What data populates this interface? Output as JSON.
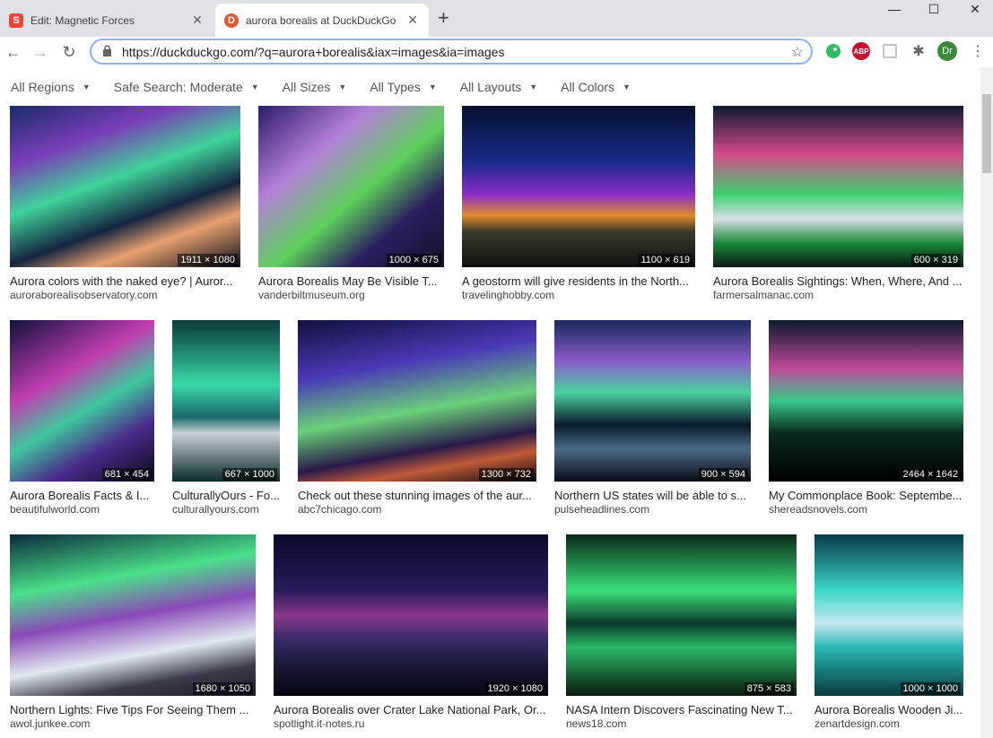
{
  "tabs": [
    {
      "title": "Edit: Magnetic Forces",
      "favicon": "S"
    },
    {
      "title": "aurora borealis at DuckDuckGo",
      "favicon": "D"
    }
  ],
  "address": {
    "url": "https://duckduckgo.com/?q=aurora+borealis&iax=images&ia=images"
  },
  "profile": {
    "initials": "Dr"
  },
  "extensions": {
    "abp": "ABP"
  },
  "filters": [
    "All Regions",
    "Safe Search: Moderate",
    "All Sizes",
    "All Types",
    "All Layouts",
    "All Colors"
  ],
  "results": [
    {
      "caption": "Aurora colors with the naked eye? | Auror...",
      "source": "auroraborealisobservatory.com",
      "dims": "1911 × 1080"
    },
    {
      "caption": "Aurora Borealis May Be Visible T...",
      "source": "vanderbiltmuseum.org",
      "dims": "1000 × 675"
    },
    {
      "caption": "A geostorm will give residents in the North...",
      "source": "travelinghobby.com",
      "dims": "1100 × 619"
    },
    {
      "caption": "Aurora Borealis Sightings: When, Where, And ...",
      "source": "farmersalmanac.com",
      "dims": "600 × 319"
    },
    {
      "caption": "Aurora Borealis Facts & I...",
      "source": "beautifulworld.com",
      "dims": "681 × 454"
    },
    {
      "caption": "CulturallyOurs - Fo...",
      "source": "culturallyours.com",
      "dims": "667 × 1000"
    },
    {
      "caption": "Check out these stunning images of the aur...",
      "source": "abc7chicago.com",
      "dims": "1300 × 732"
    },
    {
      "caption": "Northern US states will be able to s...",
      "source": "pulseheadlines.com",
      "dims": "900 × 594"
    },
    {
      "caption": "My Commonplace Book: Septembe...",
      "source": "shereadsnovels.com",
      "dims": "2464 × 1642"
    },
    {
      "caption": "Northern Lights: Five Tips For Seeing Them ...",
      "source": "awol.junkee.com",
      "dims": "1680 × 1050"
    },
    {
      "caption": "Aurora Borealis over Crater Lake National Park, Or...",
      "source": "spotlight.it-notes.ru",
      "dims": "1920 × 1080"
    },
    {
      "caption": "NASA Intern Discovers Fascinating New T...",
      "source": "news18.com",
      "dims": "875 × 583"
    },
    {
      "caption": "Aurora Borealis Wooden Ji...",
      "source": "zenartdesign.com",
      "dims": "1000 × 1000"
    }
  ]
}
